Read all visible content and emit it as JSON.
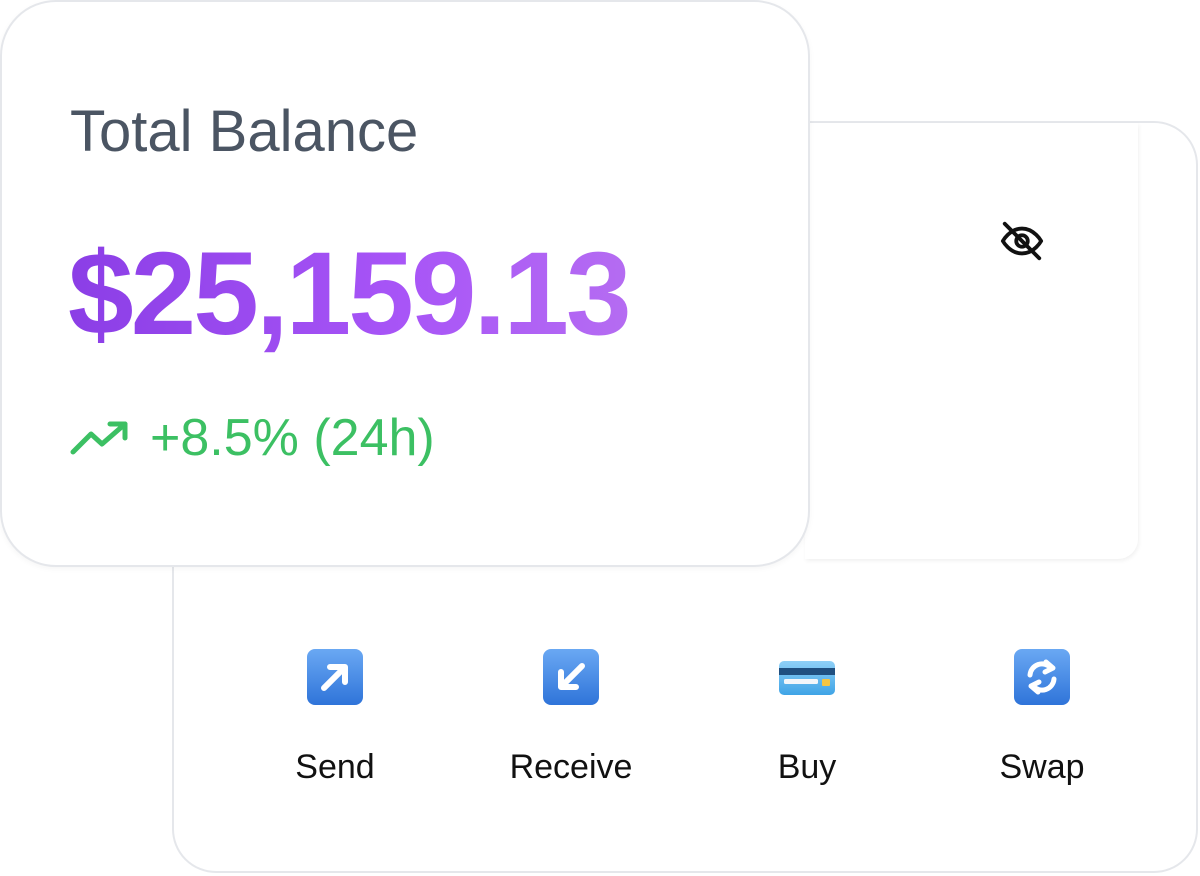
{
  "balance": {
    "title": "Total Balance",
    "amount": "$25,159.13",
    "change": "+8.5% (24h)",
    "trend_icon": "trending-up-icon",
    "amount_gradient": [
      "#8b3ee6",
      "#b56cf2"
    ],
    "change_color": "#3cc063"
  },
  "visibility_toggle": {
    "icon": "eye-off-icon"
  },
  "actions": [
    {
      "label": "Send",
      "icon": "arrow-up-right-icon"
    },
    {
      "label": "Receive",
      "icon": "arrow-down-left-icon"
    },
    {
      "label": "Buy",
      "icon": "credit-card-icon"
    },
    {
      "label": "Swap",
      "icon": "swap-arrows-icon"
    }
  ]
}
